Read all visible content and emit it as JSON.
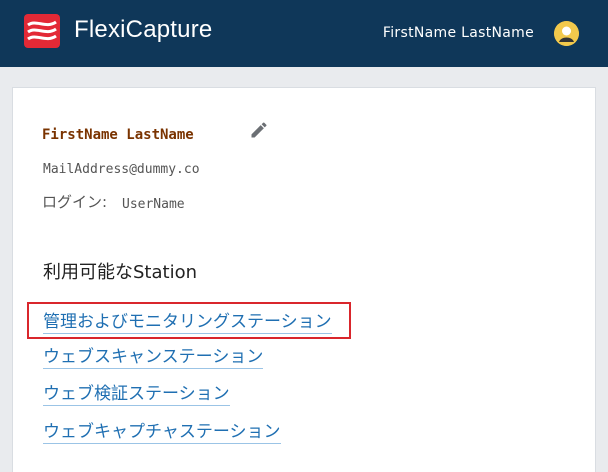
{
  "header": {
    "app_title": "FlexiCapture",
    "user_name": "FirstName LastName",
    "logo_icon": "flexicapture-logo",
    "avatar_icon": "user-avatar-icon",
    "brand_color": "#0f3759",
    "logo_color": "#e32936"
  },
  "profile": {
    "name": "FirstName LastName",
    "email": "MailAddress@dummy.co",
    "login_label": "ログイン:",
    "login_value": "UserName",
    "edit_icon": "pencil-icon"
  },
  "stations": {
    "title": "利用可能なStation",
    "items": [
      {
        "label": "管理およびモニタリングステーション",
        "highlighted": true
      },
      {
        "label": "ウェブスキャンステーション",
        "highlighted": false
      },
      {
        "label": "ウェブ検証ステーション",
        "highlighted": false
      },
      {
        "label": "ウェブキャプチャステーション",
        "highlighted": false
      }
    ],
    "link_color": "#1f6fb2",
    "highlight_color": "#d9262c"
  }
}
